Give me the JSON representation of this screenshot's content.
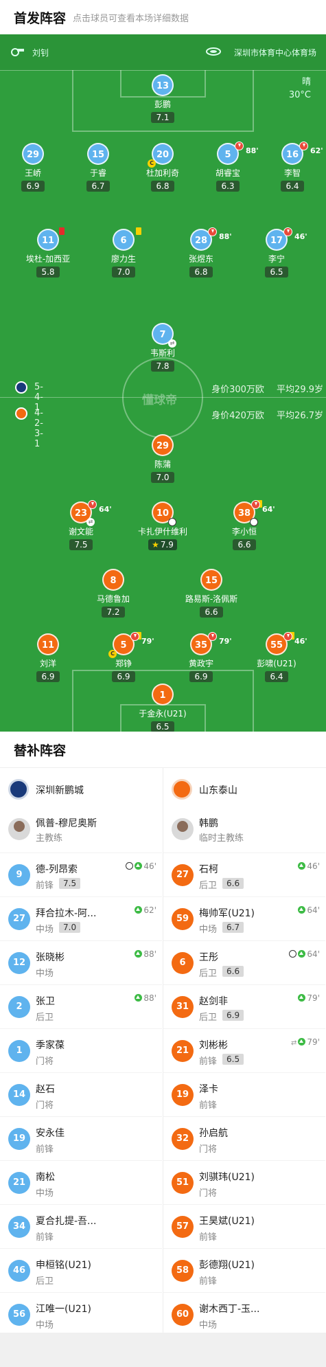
{
  "header": {
    "title": "首发阵容",
    "hint": "点击球员可查看本场详细数据"
  },
  "pitch": {
    "referee": "刘钊",
    "stadium": "深圳市体育中心体育场",
    "weather": "晴",
    "temperature": "30°C",
    "watermark": "懂球帝",
    "home_team": {
      "formation": "5-4-1",
      "value": "身价300万欧",
      "avg_age": "平均29.9岁"
    },
    "away_team": {
      "formation": "4-2-3-1",
      "value": "身价420万欧",
      "avg_age": "平均26.7岁"
    }
  },
  "home_players": [
    {
      "number": "13",
      "name": "彭鹏",
      "rating": "7.1",
      "events": []
    },
    {
      "number": "29",
      "name": "王峤",
      "rating": "6.9",
      "events": []
    },
    {
      "number": "15",
      "name": "于睿",
      "rating": "6.7",
      "events": []
    },
    {
      "number": "20",
      "name": "杜加利奇",
      "rating": "6.8",
      "events": [
        "captain"
      ]
    },
    {
      "number": "5",
      "name": "胡睿宝",
      "rating": "6.3",
      "events": [
        "sub"
      ],
      "minute": "88'"
    },
    {
      "number": "16",
      "name": "李智",
      "rating": "6.4",
      "events": [
        "sub"
      ],
      "minute": "62'"
    },
    {
      "number": "11",
      "name": "埃杜-加西亚",
      "rating": "5.8",
      "events": [
        "red"
      ]
    },
    {
      "number": "6",
      "name": "廖力生",
      "rating": "7.0",
      "events": [
        "yellow"
      ]
    },
    {
      "number": "28",
      "name": "张煜东",
      "rating": "6.8",
      "events": [
        "sub"
      ],
      "minute": "88'"
    },
    {
      "number": "17",
      "name": "李宁",
      "rating": "6.5",
      "events": [
        "sub"
      ],
      "minute": "46'"
    },
    {
      "number": "7",
      "name": "韦斯利",
      "rating": "7.8",
      "events": [
        "swap"
      ]
    }
  ],
  "away_players": [
    {
      "number": "29",
      "name": "陈蒲",
      "rating": "7.0",
      "events": []
    },
    {
      "number": "23",
      "name": "谢文能",
      "rating": "7.5",
      "events": [
        "sub",
        "swap"
      ],
      "minute": "64'"
    },
    {
      "number": "10",
      "name": "卡扎伊什维利",
      "rating": "7.9",
      "events": [
        "ball",
        "star"
      ]
    },
    {
      "number": "38",
      "name": "李小恒",
      "rating": "6.6",
      "events": [
        "yellow",
        "sub",
        "ball"
      ],
      "minute": "64'"
    },
    {
      "number": "8",
      "name": "马德鲁加",
      "rating": "7.2",
      "events": []
    },
    {
      "number": "15",
      "name": "路易斯-洛佩斯",
      "rating": "6.6",
      "events": []
    },
    {
      "number": "11",
      "name": "刘洋",
      "rating": "6.9",
      "events": []
    },
    {
      "number": "5",
      "name": "郑铮",
      "rating": "6.9",
      "events": [
        "yellow",
        "sub",
        "captain"
      ],
      "minute": "79'"
    },
    {
      "number": "35",
      "name": "黄政宇",
      "rating": "6.9",
      "events": [
        "sub"
      ],
      "minute": "79'"
    },
    {
      "number": "55",
      "name": "彭啸(U21)",
      "rating": "6.4",
      "events": [
        "yellow",
        "sub"
      ],
      "minute": "46'"
    },
    {
      "number": "1",
      "name": "于金永(U21)",
      "rating": "6.5",
      "events": []
    }
  ],
  "subs": {
    "title": "替补阵容",
    "home": {
      "team_name": "深圳新鹏城",
      "coach": {
        "name": "佩普-穆尼奥斯",
        "role": "主教练"
      },
      "players": [
        {
          "number": "9",
          "name": "德-列昂索",
          "position": "前锋",
          "rating": "7.5",
          "event": "46'",
          "icons": [
            "ball",
            "up"
          ]
        },
        {
          "number": "27",
          "name": "拜合拉木-阿...",
          "position": "中场",
          "rating": "7.0",
          "event": "62'",
          "icons": [
            "up"
          ]
        },
        {
          "number": "12",
          "name": "张晓彬",
          "position": "中场",
          "rating": "",
          "event": "88'",
          "icons": [
            "up"
          ]
        },
        {
          "number": "2",
          "name": "张卫",
          "position": "后卫",
          "rating": "",
          "event": "88'",
          "icons": [
            "up"
          ]
        },
        {
          "number": "1",
          "name": "季家葆",
          "position": "门将",
          "rating": "",
          "event": "",
          "icons": []
        },
        {
          "number": "14",
          "name": "赵石",
          "position": "门将",
          "rating": "",
          "event": "",
          "icons": []
        },
        {
          "number": "19",
          "name": "安永佳",
          "position": "前锋",
          "rating": "",
          "event": "",
          "icons": []
        },
        {
          "number": "21",
          "name": "南松",
          "position": "中场",
          "rating": "",
          "event": "",
          "icons": []
        },
        {
          "number": "34",
          "name": "夏合扎提-吾...",
          "position": "前锋",
          "rating": "",
          "event": "",
          "icons": []
        },
        {
          "number": "46",
          "name": "申桓铭(U21)",
          "position": "后卫",
          "rating": "",
          "event": "",
          "icons": []
        },
        {
          "number": "56",
          "name": "江唯一(U21)",
          "position": "中场",
          "rating": "",
          "event": "",
          "icons": []
        }
      ]
    },
    "away": {
      "team_name": "山东泰山",
      "coach": {
        "name": "韩鹏",
        "role": "临时主教练"
      },
      "players": [
        {
          "number": "27",
          "name": "石柯",
          "position": "后卫",
          "rating": "6.6",
          "event": "46'",
          "icons": [
            "up"
          ]
        },
        {
          "number": "59",
          "name": "梅帅军(U21)",
          "position": "中场",
          "rating": "6.7",
          "event": "64'",
          "icons": [
            "up"
          ]
        },
        {
          "number": "6",
          "name": "王彤",
          "position": "后卫",
          "rating": "6.6",
          "event": "64'",
          "icons": [
            "ball",
            "up"
          ]
        },
        {
          "number": "31",
          "name": "赵剑非",
          "position": "后卫",
          "rating": "6.9",
          "event": "79'",
          "icons": [
            "up"
          ]
        },
        {
          "number": "21",
          "name": "刘彬彬",
          "position": "前锋",
          "rating": "6.5",
          "event": "79'",
          "icons": [
            "swap",
            "up"
          ]
        },
        {
          "number": "19",
          "name": "泽卡",
          "position": "前锋",
          "rating": "",
          "event": "",
          "icons": []
        },
        {
          "number": "32",
          "name": "孙启航",
          "position": "门将",
          "rating": "",
          "event": "",
          "icons": []
        },
        {
          "number": "51",
          "name": "刘骐玮(U21)",
          "position": "门将",
          "rating": "",
          "event": "",
          "icons": []
        },
        {
          "number": "57",
          "name": "王昊斌(U21)",
          "position": "前锋",
          "rating": "",
          "event": "",
          "icons": []
        },
        {
          "number": "58",
          "name": "彭德翔(U21)",
          "position": "前锋",
          "rating": "",
          "event": "",
          "icons": []
        },
        {
          "number": "60",
          "name": "谢木西丁-玉...",
          "position": "中场",
          "rating": "",
          "event": "",
          "icons": []
        }
      ]
    }
  },
  "colors": {
    "home": "#5fb3ee",
    "away": "#f36a12",
    "pitch": "#2f9e3d"
  }
}
